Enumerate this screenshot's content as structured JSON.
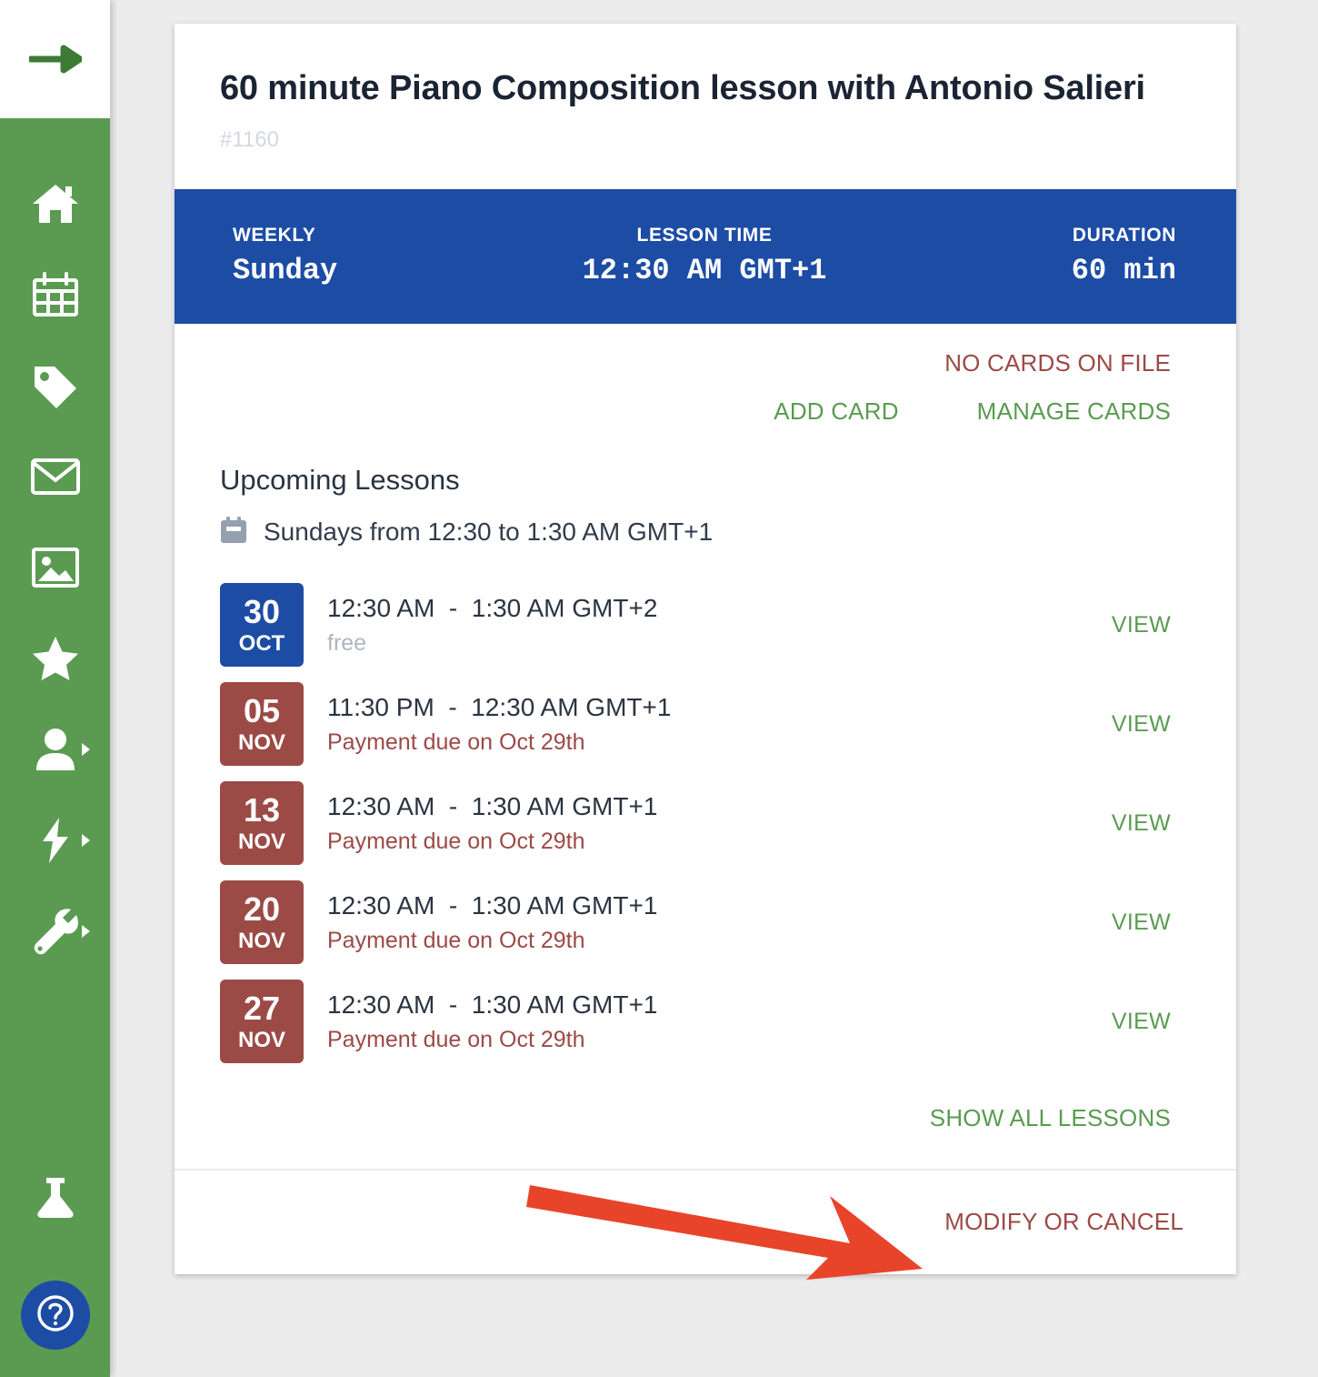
{
  "colors": {
    "sidebar_green": "#5a9b51",
    "accent_blue": "#1d4ca5",
    "accent_red": "#9c4a46",
    "link_green": "#5a9b51",
    "page_background": "#ececec",
    "arrow_red": "#e8442a"
  },
  "sidebar": {
    "toggle": {
      "icon": "arrow-right-icon",
      "label": "Expand menu"
    },
    "items": [
      {
        "icon": "home-icon",
        "name": "home",
        "has_submenu": false
      },
      {
        "icon": "calendar-icon",
        "name": "calendar",
        "has_submenu": false
      },
      {
        "icon": "tag-icon",
        "name": "tags",
        "has_submenu": false
      },
      {
        "icon": "envelope-icon",
        "name": "messages",
        "has_submenu": false
      },
      {
        "icon": "image-icon",
        "name": "media",
        "has_submenu": false
      },
      {
        "icon": "star-icon",
        "name": "reviews",
        "has_submenu": false
      },
      {
        "icon": "user-icon",
        "name": "students",
        "has_submenu": true
      },
      {
        "icon": "bolt-icon",
        "name": "activity",
        "has_submenu": true
      },
      {
        "icon": "wrench-icon",
        "name": "settings",
        "has_submenu": true
      }
    ],
    "bottom": [
      {
        "icon": "flask-icon",
        "name": "labs"
      },
      {
        "icon": "question-mark-icon",
        "name": "help"
      }
    ]
  },
  "card": {
    "title": "60 minute Piano Composition lesson with Antonio Salieri",
    "id": "#1160"
  },
  "summary": {
    "recurrence_label": "WEEKLY",
    "recurrence_value": "Sunday",
    "time_label": "LESSON TIME",
    "time_value": "12:30 AM GMT+1",
    "duration_label": "DURATION",
    "duration_value": "60 min"
  },
  "payment": {
    "status": "NO CARDS ON FILE",
    "add_card": "ADD CARD",
    "manage_cards": "MANAGE CARDS"
  },
  "upcoming": {
    "heading": "Upcoming Lessons",
    "recurrence_summary": "Sundays from 12:30 to 1:30 AM GMT+1",
    "view_label": "VIEW",
    "show_all": "SHOW ALL LESSONS",
    "lessons": [
      {
        "day": "30",
        "month": "OCT",
        "badge_color": "blue",
        "time": "12:30 AM  -  1:30 AM GMT+2",
        "note": "free",
        "note_type": "free",
        "action": "VIEW"
      },
      {
        "day": "05",
        "month": "NOV",
        "badge_color": "red",
        "time": "11:30 PM  -  12:30 AM GMT+1",
        "note": "Payment due on Oct 29th",
        "note_type": "due",
        "action": "VIEW"
      },
      {
        "day": "13",
        "month": "NOV",
        "badge_color": "red",
        "time": "12:30 AM  -  1:30 AM GMT+1",
        "note": "Payment due on Oct 29th",
        "note_type": "due",
        "action": "VIEW"
      },
      {
        "day": "20",
        "month": "NOV",
        "badge_color": "red",
        "time": "12:30 AM  -  1:30 AM GMT+1",
        "note": "Payment due on Oct 29th",
        "note_type": "due",
        "action": "VIEW"
      },
      {
        "day": "27",
        "month": "NOV",
        "badge_color": "red",
        "time": "12:30 AM  -  1:30 AM GMT+1",
        "note": "Payment due on Oct 29th",
        "note_type": "due",
        "action": "VIEW"
      }
    ]
  },
  "footer": {
    "modify_or_cancel": "MODIFY OR CANCEL"
  },
  "annotation": {
    "type": "arrow",
    "points_to": "MODIFY OR CANCEL"
  }
}
